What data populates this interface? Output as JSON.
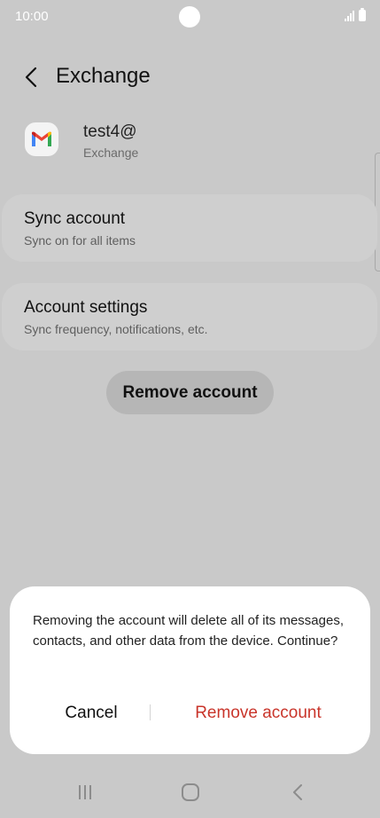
{
  "status_bar": {
    "time": "10:00"
  },
  "header": {
    "title": "Exchange",
    "back_icon": "chevron-left-icon"
  },
  "account": {
    "email": "test4@",
    "type": "Exchange",
    "app_icon": "gmail-icon"
  },
  "cards": [
    {
      "title": "Sync account",
      "subtitle": "Sync on for all items"
    },
    {
      "title": "Account settings",
      "subtitle": "Sync frequency, notifications, etc."
    }
  ],
  "remove_button": {
    "label": "Remove account"
  },
  "dialog": {
    "message": "Removing the account will delete all of its messages, contacts, and other data from the device. Continue?",
    "cancel_label": "Cancel",
    "confirm_label": "Remove account",
    "confirm_color": "#c9352b"
  },
  "nav_bar": {
    "icons": [
      "recents-icon",
      "home-icon",
      "back-icon"
    ]
  }
}
